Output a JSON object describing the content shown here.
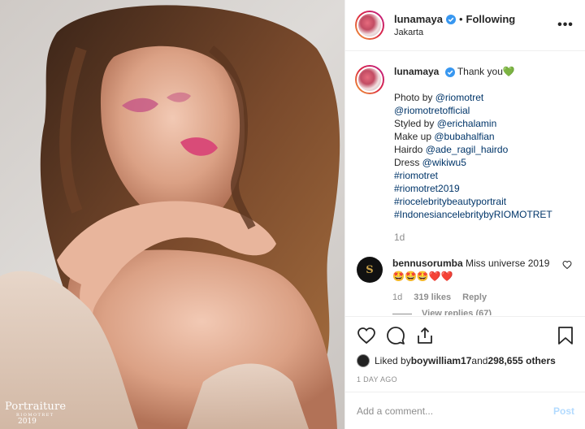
{
  "post": {
    "username": "lunamaya",
    "dot": "•",
    "follow_status": "Following",
    "location": "Jakarta",
    "more_label": "•••"
  },
  "photo": {
    "watermark_title": "Portraiture",
    "watermark_sub": "RIOMOTRET",
    "watermark_year": "2019"
  },
  "caption": {
    "username": "lunamaya",
    "text": "Thank you",
    "heart_emoji": "💚",
    "lines": [
      {
        "prefix": "Photo by ",
        "link": "@riomotret"
      },
      {
        "prefix": "",
        "link": "@riomotretofficial"
      },
      {
        "prefix": "Styled by ",
        "link": "@erichalamin"
      },
      {
        "prefix": "Make up ",
        "link": "@bubahalfian"
      },
      {
        "prefix": "Hairdo ",
        "link": "@ade_ragil_hairdo"
      },
      {
        "prefix": "Dress ",
        "link": "@wikiwu5"
      },
      {
        "prefix": "",
        "link": "#riomotret"
      },
      {
        "prefix": "",
        "link": "#riomotret2019"
      },
      {
        "prefix": "",
        "link": "#riocelebritybeautyportrait"
      },
      {
        "prefix": "",
        "link": "#IndonesiancelebritybyRIOMOTRET"
      }
    ],
    "time": "1d"
  },
  "comment": {
    "username": "bennusorumba",
    "text": "Miss universe 2019🤩🤩🤩❤️❤️",
    "avatar_text": "S",
    "time": "1d",
    "likes": "319 likes",
    "reply": "Reply",
    "view_replies": "View replies (67)"
  },
  "actions": {
    "liked_by_prefix": "Liked by ",
    "liked_by_user": "boywilliam17",
    "liked_by_and": " and ",
    "liked_by_count": "298,655 others",
    "time": "1 DAY AGO"
  },
  "add_comment": {
    "placeholder": "Add a comment...",
    "post_label": "Post"
  },
  "colors": {
    "verified": "#3897f0",
    "link": "#003569",
    "post_disabled": "#b3dbff",
    "heart_red": "#ed4956"
  }
}
